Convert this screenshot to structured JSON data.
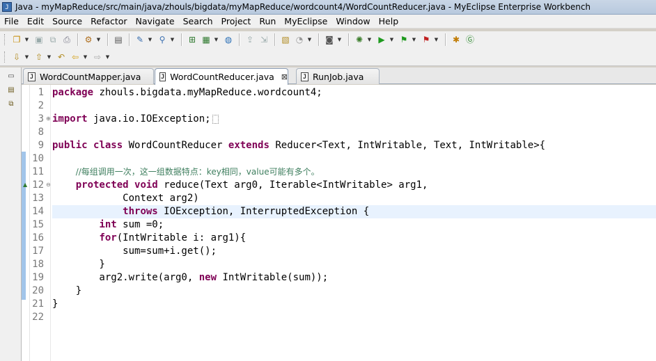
{
  "window": {
    "title": "Java - myMapReduce/src/main/java/zhouls/bigdata/myMapReduce/wordcount4/WordCountReducer.java - MyEclipse Enterprise Workbench"
  },
  "menu": [
    "File",
    "Edit",
    "Source",
    "Refactor",
    "Navigate",
    "Search",
    "Project",
    "Run",
    "MyEclipse",
    "Window",
    "Help"
  ],
  "tabs": [
    {
      "label": "WordCountMapper.java",
      "active": false
    },
    {
      "label": "WordCountReducer.java",
      "active": true
    },
    {
      "label": "RunJob.java",
      "active": false
    }
  ],
  "editor": {
    "current_line": "14",
    "lines": [
      {
        "num": "1",
        "tokens": [
          {
            "t": "kw",
            "v": "package"
          },
          {
            "t": "n",
            "v": " zhouls.bigdata.myMapReduce.wordcount4;"
          }
        ]
      },
      {
        "num": "2",
        "tokens": []
      },
      {
        "num": "3",
        "fold": "⊕",
        "tokens": [
          {
            "t": "kw",
            "v": "import"
          },
          {
            "t": "n",
            "v": " java.io.IOException;"
          }
        ],
        "collapsed": true
      },
      {
        "num": "8",
        "tokens": []
      },
      {
        "num": "9",
        "tokens": [
          {
            "t": "kw",
            "v": "public"
          },
          {
            "t": "n",
            "v": " "
          },
          {
            "t": "kw",
            "v": "class"
          },
          {
            "t": "n",
            "v": " WordCountReducer "
          },
          {
            "t": "kw",
            "v": "extends"
          },
          {
            "t": "n",
            "v": " Reducer<Text, IntWritable, Text, IntWritable>{"
          }
        ]
      },
      {
        "num": "10",
        "tokens": []
      },
      {
        "num": "11",
        "tokens": [
          {
            "t": "n",
            "v": "    "
          },
          {
            "t": "cm",
            "v": "//每组调用一次，这一组数据特点：key相同，value可能有多个。"
          }
        ]
      },
      {
        "num": "12",
        "fold": "⊖",
        "override": true,
        "tokens": [
          {
            "t": "n",
            "v": "    "
          },
          {
            "t": "kw",
            "v": "protected"
          },
          {
            "t": "n",
            "v": " "
          },
          {
            "t": "kw",
            "v": "void"
          },
          {
            "t": "n",
            "v": " reduce(Text arg0, Iterable<IntWritable> arg1,"
          }
        ]
      },
      {
        "num": "13",
        "tokens": [
          {
            "t": "n",
            "v": "            Context arg2)"
          }
        ]
      },
      {
        "num": "14",
        "tokens": [
          {
            "t": "n",
            "v": "            "
          },
          {
            "t": "kw",
            "v": "throws"
          },
          {
            "t": "n",
            "v": " IOException, InterruptedException {"
          }
        ]
      },
      {
        "num": "15",
        "tokens": [
          {
            "t": "n",
            "v": "        "
          },
          {
            "t": "kw",
            "v": "int"
          },
          {
            "t": "n",
            "v": " sum =0;"
          }
        ]
      },
      {
        "num": "16",
        "tokens": [
          {
            "t": "n",
            "v": "        "
          },
          {
            "t": "kw",
            "v": "for"
          },
          {
            "t": "n",
            "v": "(IntWritable i: arg1){"
          }
        ]
      },
      {
        "num": "17",
        "tokens": [
          {
            "t": "n",
            "v": "            sum=sum+i.get();"
          }
        ]
      },
      {
        "num": "18",
        "tokens": [
          {
            "t": "n",
            "v": "        }"
          }
        ]
      },
      {
        "num": "19",
        "tokens": [
          {
            "t": "n",
            "v": "        arg2.write(arg0, "
          },
          {
            "t": "kw",
            "v": "new"
          },
          {
            "t": "n",
            "v": " IntWritable(sum));"
          }
        ]
      },
      {
        "num": "20",
        "tokens": [
          {
            "t": "n",
            "v": "    }"
          }
        ]
      },
      {
        "num": "21",
        "tokens": [
          {
            "t": "n",
            "v": "}"
          }
        ]
      },
      {
        "num": "22",
        "tokens": []
      }
    ]
  }
}
